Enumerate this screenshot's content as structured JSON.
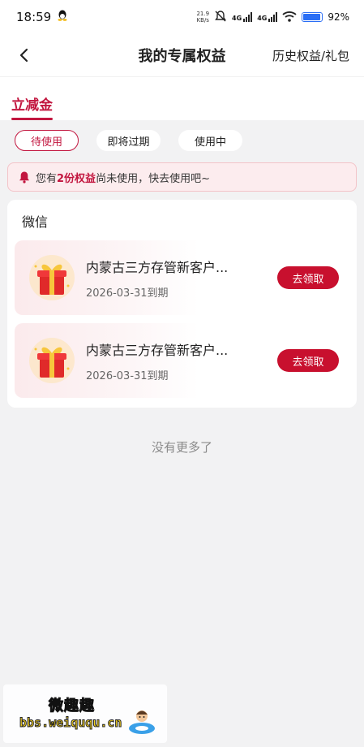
{
  "status_bar": {
    "time": "18:59",
    "net_speed_value": "21.9",
    "net_speed_unit": "KB/s",
    "net_type_1": "4G",
    "net_type_2": "4G",
    "battery": "92%"
  },
  "header": {
    "title": "我的专属权益",
    "right_link": "历史权益/礼包"
  },
  "main_tab": "立减金",
  "filters": [
    {
      "label": "待使用",
      "active": true
    },
    {
      "label": "即将过期",
      "active": false
    },
    {
      "label": "使用中",
      "active": false
    }
  ],
  "notice": {
    "prefix": "您有",
    "highlight": "2份权益",
    "suffix": "尚未使用，快去使用吧~"
  },
  "section": {
    "title": "微信",
    "items": [
      {
        "name": "内蒙古三方存管新客户...",
        "date": "2026-03-31到期",
        "button": "去领取"
      },
      {
        "name": "内蒙古三方存管新客户...",
        "date": "2026-03-31到期",
        "button": "去领取"
      }
    ]
  },
  "footer_text": "没有更多了",
  "watermark": {
    "title": "微趣趣",
    "url": "bbs.weiququ.cn"
  },
  "colors": {
    "accent": "#c2163f",
    "button": "#c8102e",
    "notice_bg": "#fcecee",
    "page_bg": "#f2f2f3"
  }
}
